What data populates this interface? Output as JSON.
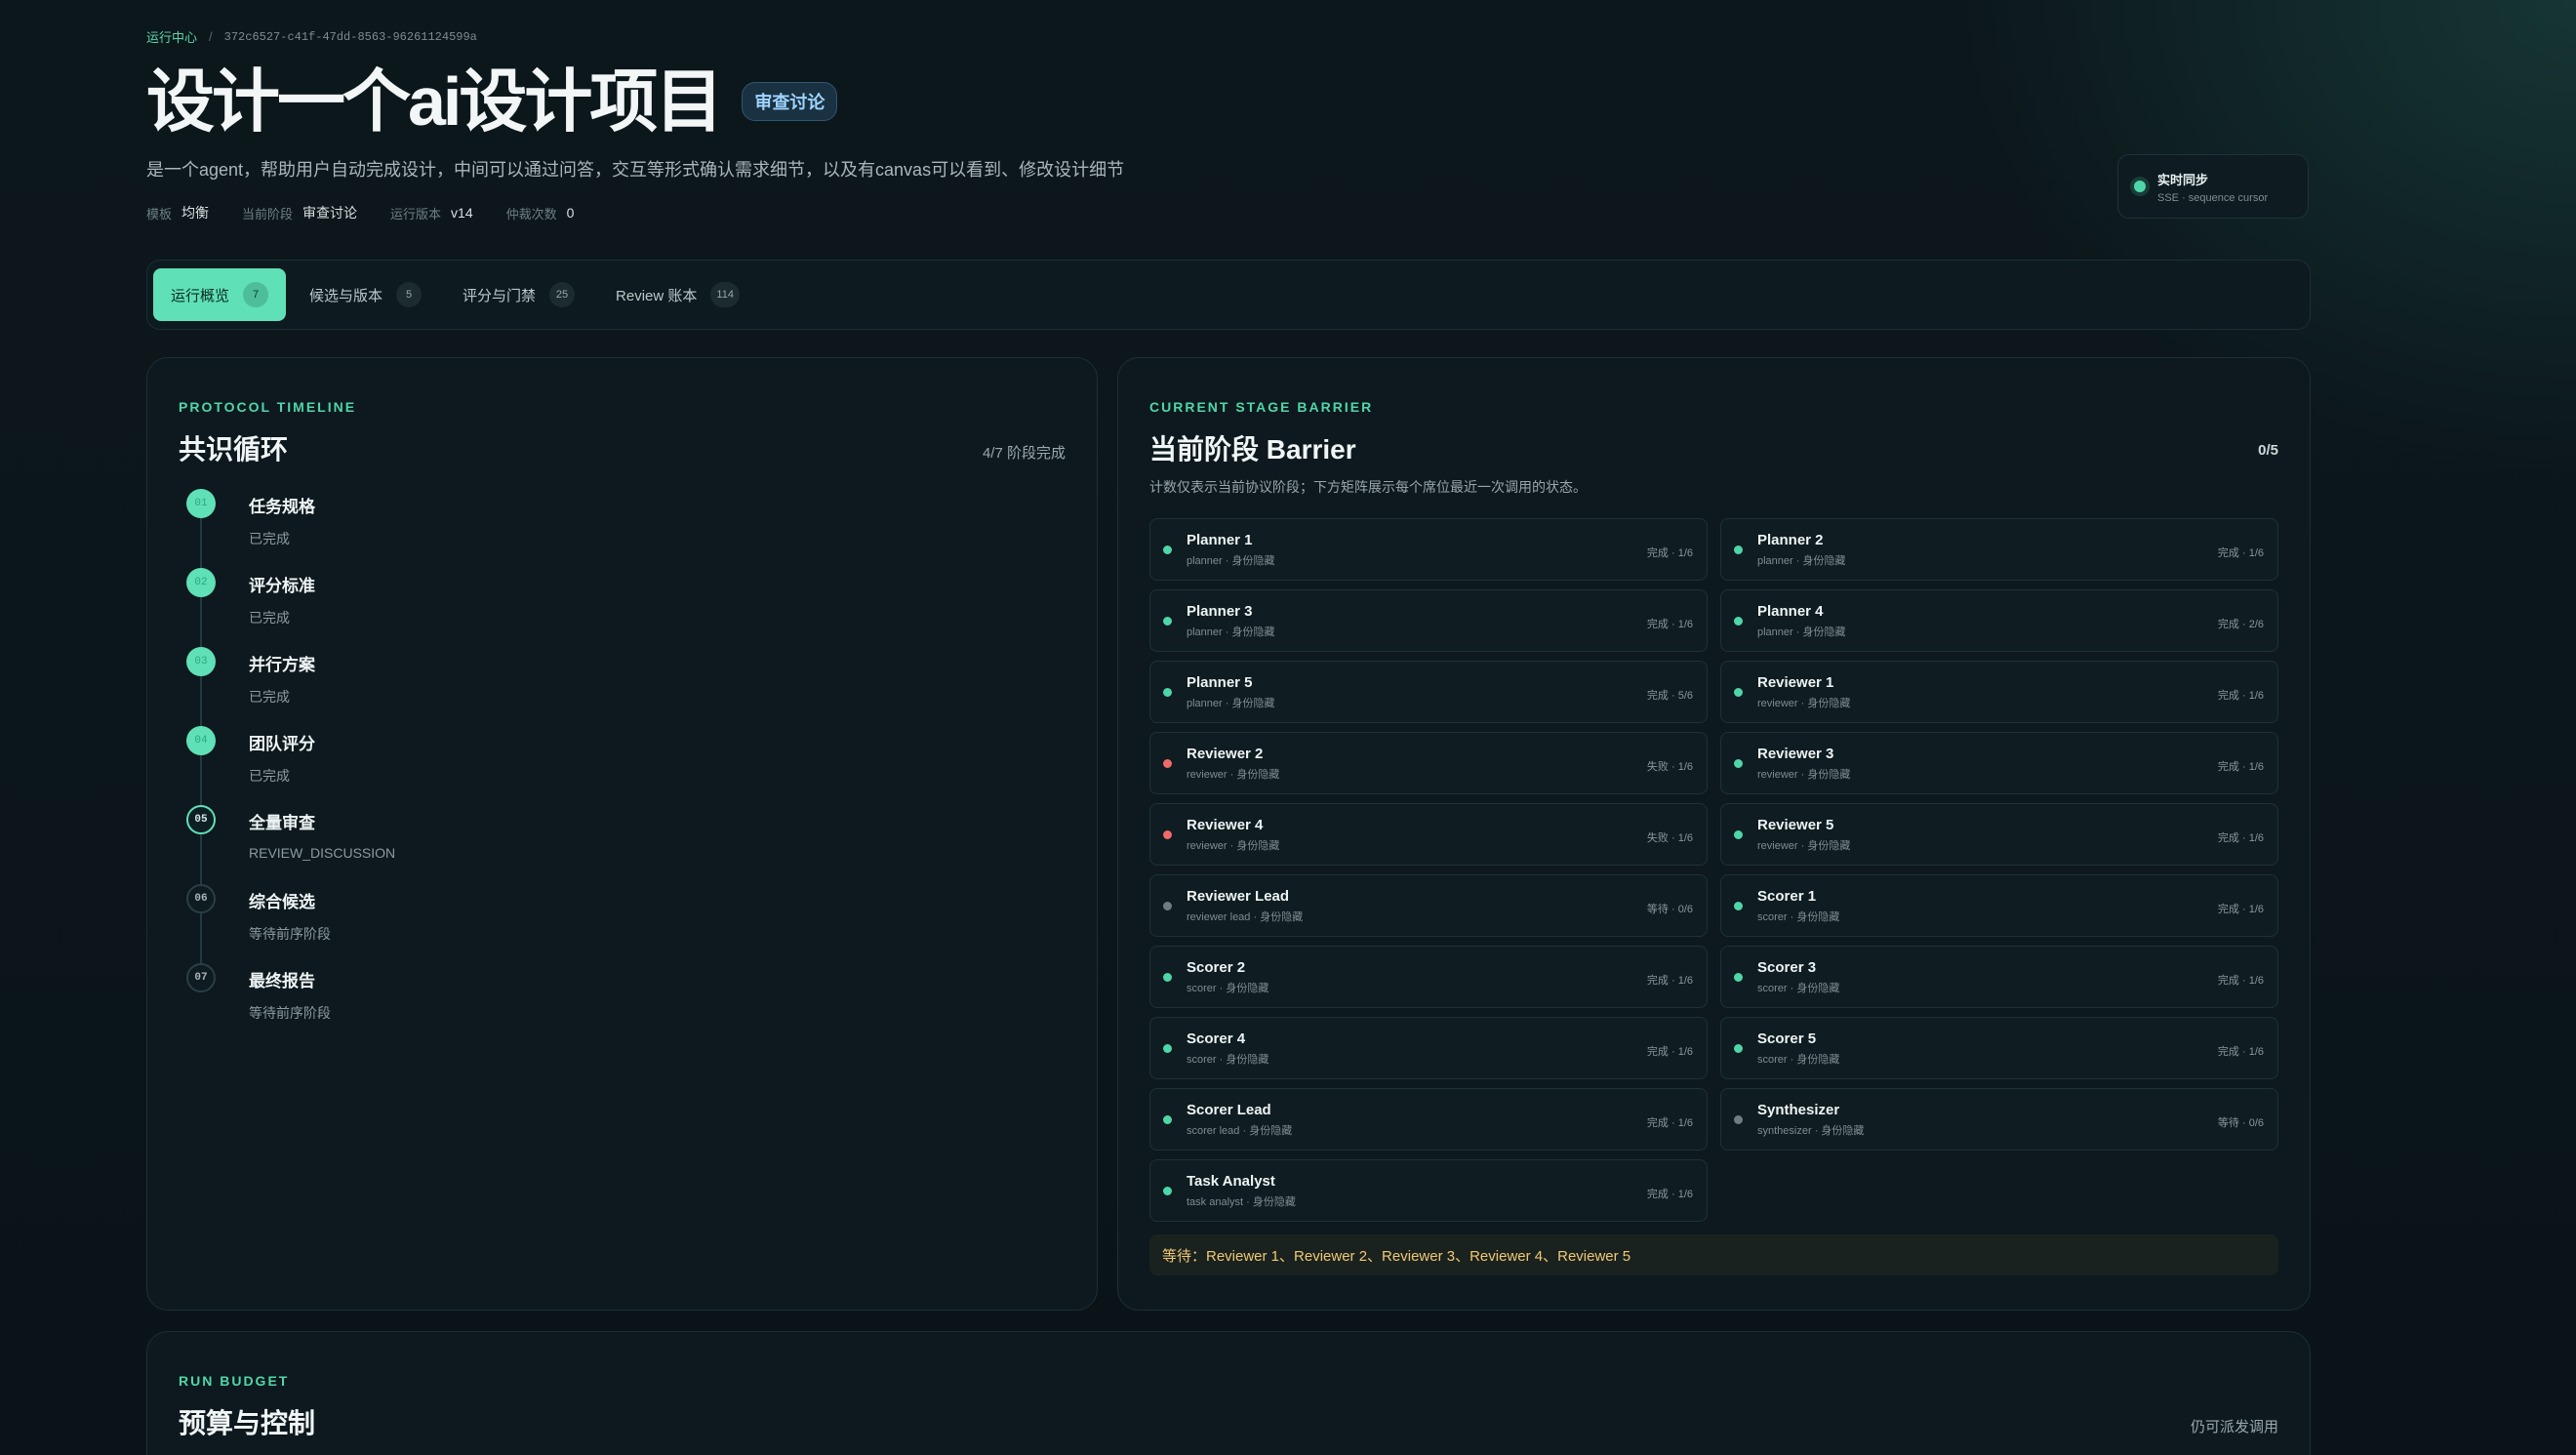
{
  "breadcrumb": {
    "root": "运行中心",
    "separator": "/",
    "run_id": "372c6527-c41f-47dd-8563-96261124599a"
  },
  "header": {
    "title": "设计一个ai设计项目",
    "badge": "审查讨论",
    "subtitle": "是一个agent，帮助用户自动完成设计，中间可以通过问答，交互等形式确认需求细节，以及有canvas可以看到、修改设计细节",
    "meta": [
      {
        "label": "模板",
        "value": "均衡"
      },
      {
        "label": "当前阶段",
        "value": "审查讨论"
      },
      {
        "label": "运行版本",
        "value": "v14"
      },
      {
        "label": "仲裁次数",
        "value": "0"
      }
    ]
  },
  "sync": {
    "title": "实时同步",
    "subtitle": "SSE · sequence cursor",
    "status_color": "#4fd6a8"
  },
  "tabs": [
    {
      "label": "运行概览",
      "count": "7",
      "active": true
    },
    {
      "label": "候选与版本",
      "count": "5",
      "active": false
    },
    {
      "label": "评分与门禁",
      "count": "25",
      "active": false
    },
    {
      "label": "Review 账本",
      "count": "114",
      "active": false
    }
  ],
  "timeline": {
    "eyebrow": "PROTOCOL TIMELINE",
    "title": "共识循环",
    "progress": "4/7 阶段完成",
    "steps": [
      {
        "num": "01",
        "name": "任务规格",
        "status": "已完成",
        "state": "done"
      },
      {
        "num": "02",
        "name": "评分标准",
        "status": "已完成",
        "state": "done"
      },
      {
        "num": "03",
        "name": "并行方案",
        "status": "已完成",
        "state": "done"
      },
      {
        "num": "04",
        "name": "团队评分",
        "status": "已完成",
        "state": "done"
      },
      {
        "num": "05",
        "name": "全量审查",
        "status": "REVIEW_DISCUSSION",
        "state": "active"
      },
      {
        "num": "06",
        "name": "综合候选",
        "status": "等待前序阶段",
        "state": "wait"
      },
      {
        "num": "07",
        "name": "最终报告",
        "status": "等待前序阶段",
        "state": "wait"
      }
    ]
  },
  "barrier": {
    "eyebrow": "CURRENT STAGE BARRIER",
    "title": "当前阶段 Barrier",
    "count": "0/5",
    "description": "计数仅表示当前协议阶段；下方矩阵展示每个席位最近一次调用的状态。",
    "seats": [
      {
        "name": "Planner 1",
        "role": "planner · 身份隐藏",
        "state": "完成 · 1/6",
        "status": "ok"
      },
      {
        "name": "Planner 2",
        "role": "planner · 身份隐藏",
        "state": "完成 · 1/6",
        "status": "ok"
      },
      {
        "name": "Planner 3",
        "role": "planner · 身份隐藏",
        "state": "完成 · 1/6",
        "status": "ok"
      },
      {
        "name": "Planner 4",
        "role": "planner · 身份隐藏",
        "state": "完成 · 2/6",
        "status": "ok"
      },
      {
        "name": "Planner 5",
        "role": "planner · 身份隐藏",
        "state": "完成 · 5/6",
        "status": "ok"
      },
      {
        "name": "Reviewer 1",
        "role": "reviewer · 身份隐藏",
        "state": "完成 · 1/6",
        "status": "ok"
      },
      {
        "name": "Reviewer 2",
        "role": "reviewer · 身份隐藏",
        "state": "失败 · 1/6",
        "status": "fail"
      },
      {
        "name": "Reviewer 3",
        "role": "reviewer · 身份隐藏",
        "state": "完成 · 1/6",
        "status": "ok"
      },
      {
        "name": "Reviewer 4",
        "role": "reviewer · 身份隐藏",
        "state": "失败 · 1/6",
        "status": "fail"
      },
      {
        "name": "Reviewer 5",
        "role": "reviewer · 身份隐藏",
        "state": "完成 · 1/6",
        "status": "ok"
      },
      {
        "name": "Reviewer Lead",
        "role": "reviewer lead · 身份隐藏",
        "state": "等待 · 0/6",
        "status": "wait"
      },
      {
        "name": "Scorer 1",
        "role": "scorer · 身份隐藏",
        "state": "完成 · 1/6",
        "status": "ok"
      },
      {
        "name": "Scorer 2",
        "role": "scorer · 身份隐藏",
        "state": "完成 · 1/6",
        "status": "ok"
      },
      {
        "name": "Scorer 3",
        "role": "scorer · 身份隐藏",
        "state": "完成 · 1/6",
        "status": "ok"
      },
      {
        "name": "Scorer 4",
        "role": "scorer · 身份隐藏",
        "state": "完成 · 1/6",
        "status": "ok"
      },
      {
        "name": "Scorer 5",
        "role": "scorer · 身份隐藏",
        "state": "完成 · 1/6",
        "status": "ok"
      },
      {
        "name": "Scorer Lead",
        "role": "scorer lead · 身份隐藏",
        "state": "完成 · 1/6",
        "status": "ok"
      },
      {
        "name": "Synthesizer",
        "role": "synthesizer · 身份隐藏",
        "state": "等待 · 0/6",
        "status": "wait"
      },
      {
        "name": "Task Analyst",
        "role": "task analyst · 身份隐藏",
        "state": "完成 · 1/6",
        "status": "ok"
      }
    ],
    "waiting": "等待：Reviewer 1、Reviewer 2、Reviewer 3、Reviewer 4、Reviewer 5"
  },
  "budget": {
    "eyebrow": "RUN BUDGET",
    "title": "预算与控制",
    "aside": "仍可派发调用"
  },
  "colors": {
    "accent": "#5fe0b6",
    "success": "#4fd6a8",
    "failure": "#f06a6a",
    "waiting": "#6f7d82",
    "warning_text": "#f1c873"
  }
}
